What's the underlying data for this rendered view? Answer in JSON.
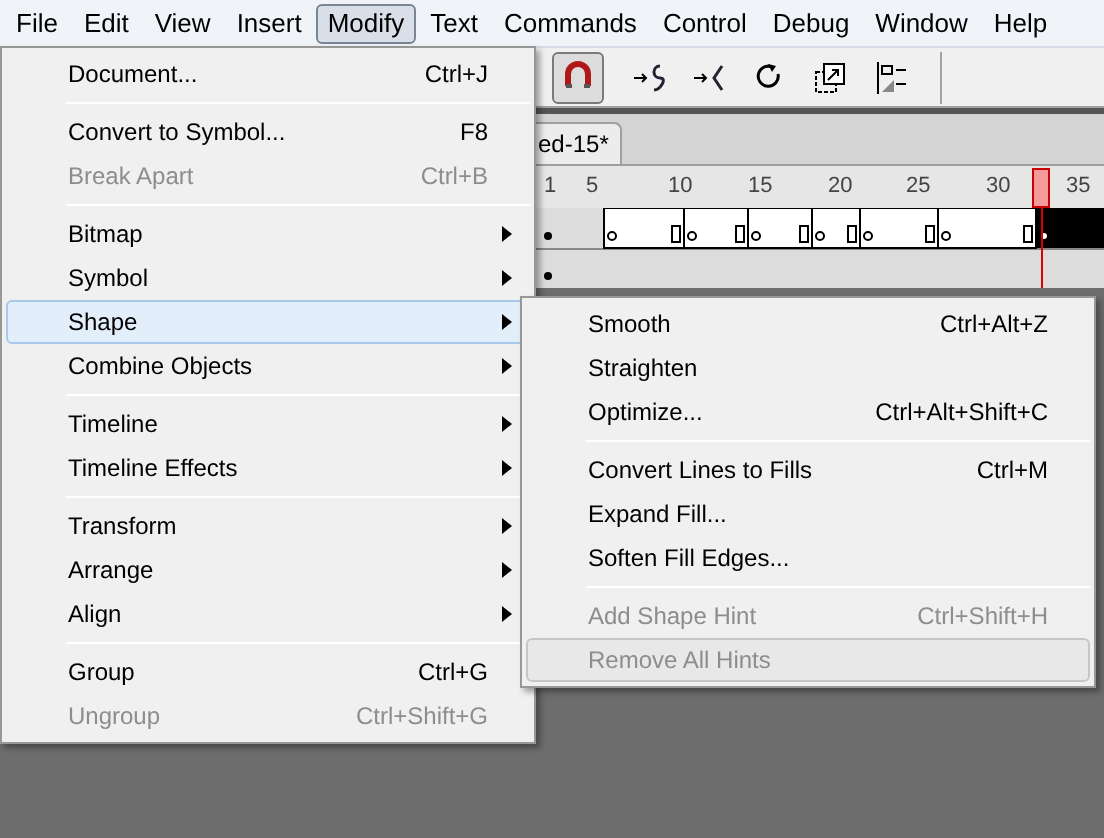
{
  "menubar": [
    {
      "label": "File",
      "selected": false
    },
    {
      "label": "Edit",
      "selected": false
    },
    {
      "label": "View",
      "selected": false
    },
    {
      "label": "Insert",
      "selected": false
    },
    {
      "label": "Modify",
      "selected": true
    },
    {
      "label": "Text",
      "selected": false
    },
    {
      "label": "Commands",
      "selected": false
    },
    {
      "label": "Control",
      "selected": false
    },
    {
      "label": "Debug",
      "selected": false
    },
    {
      "label": "Window",
      "selected": false
    },
    {
      "label": "Help",
      "selected": false
    }
  ],
  "toolbar": [
    {
      "kind": "magnet",
      "selected": true
    },
    {
      "kind": "smooth",
      "selected": false
    },
    {
      "kind": "straighten",
      "selected": false
    },
    {
      "kind": "rotate",
      "selected": false
    },
    {
      "kind": "scale",
      "selected": false
    },
    {
      "kind": "align",
      "selected": false
    }
  ],
  "document_tab": {
    "label": "ed-15*"
  },
  "timeline": {
    "ruler": [
      "1",
      "5",
      "10",
      "15",
      "20",
      "25",
      "30",
      "35"
    ]
  },
  "menu": [
    {
      "kind": "item",
      "label": "Document...",
      "shortcut": "Ctrl+J",
      "disabled": false,
      "submenu": false,
      "selected": false
    },
    {
      "kind": "separator"
    },
    {
      "kind": "item",
      "label": "Convert to Symbol...",
      "shortcut": "F8",
      "disabled": false,
      "submenu": false,
      "selected": false
    },
    {
      "kind": "item",
      "label": "Break Apart",
      "shortcut": "Ctrl+B",
      "disabled": true,
      "submenu": false,
      "selected": false
    },
    {
      "kind": "separator"
    },
    {
      "kind": "item",
      "label": "Bitmap",
      "disabled": false,
      "submenu": true,
      "selected": false
    },
    {
      "kind": "item",
      "label": "Symbol",
      "disabled": false,
      "submenu": true,
      "selected": false
    },
    {
      "kind": "item",
      "label": "Shape",
      "disabled": false,
      "submenu": true,
      "selected": true
    },
    {
      "kind": "item",
      "label": "Combine Objects",
      "disabled": false,
      "submenu": true,
      "selected": false
    },
    {
      "kind": "separator"
    },
    {
      "kind": "item",
      "label": "Timeline",
      "disabled": false,
      "submenu": true,
      "selected": false
    },
    {
      "kind": "item",
      "label": "Timeline Effects",
      "disabled": false,
      "submenu": true,
      "selected": false
    },
    {
      "kind": "separator"
    },
    {
      "kind": "item",
      "label": "Transform",
      "disabled": false,
      "submenu": true,
      "selected": false
    },
    {
      "kind": "item",
      "label": "Arrange",
      "disabled": false,
      "submenu": true,
      "selected": false
    },
    {
      "kind": "item",
      "label": "Align",
      "disabled": false,
      "submenu": true,
      "selected": false
    },
    {
      "kind": "separator"
    },
    {
      "kind": "item",
      "label": "Group",
      "shortcut": "Ctrl+G",
      "disabled": false,
      "submenu": false,
      "selected": false
    },
    {
      "kind": "item",
      "label": "Ungroup",
      "shortcut": "Ctrl+Shift+G",
      "disabled": true,
      "submenu": false,
      "selected": false
    }
  ],
  "submenu": [
    {
      "kind": "item",
      "label": "Smooth",
      "shortcut": "Ctrl+Alt+Z",
      "disabled": false,
      "selected": false
    },
    {
      "kind": "item",
      "label": "Straighten",
      "disabled": false,
      "selected": false
    },
    {
      "kind": "item",
      "label": "Optimize...",
      "shortcut": "Ctrl+Alt+Shift+C",
      "disabled": false,
      "selected": false
    },
    {
      "kind": "separator"
    },
    {
      "kind": "item",
      "label": "Convert Lines to Fills",
      "shortcut": "Ctrl+M",
      "disabled": false,
      "selected": false
    },
    {
      "kind": "item",
      "label": "Expand Fill...",
      "disabled": false,
      "selected": false
    },
    {
      "kind": "item",
      "label": "Soften Fill Edges...",
      "disabled": false,
      "selected": false
    },
    {
      "kind": "separator"
    },
    {
      "kind": "item",
      "label": "Add Shape Hint",
      "shortcut": "Ctrl+Shift+H",
      "disabled": true,
      "selected": false
    },
    {
      "kind": "item",
      "label": "Remove All Hints",
      "disabled": true,
      "selected": true
    }
  ]
}
